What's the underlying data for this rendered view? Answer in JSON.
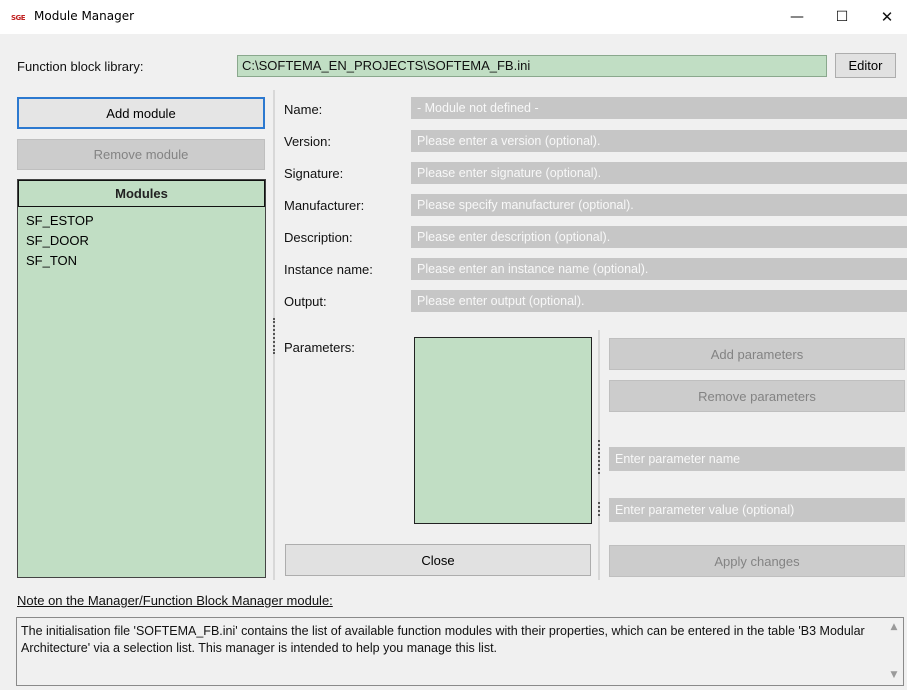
{
  "window": {
    "title": "Module Manager",
    "icon_text": "SGE",
    "min_glyph": "—",
    "max_glyph": "☐",
    "close_glyph": "✕"
  },
  "library": {
    "label": "Function block library:",
    "path": "C:\\SOFTEMA_EN_PROJECTS\\SOFTEMA_FB.ini",
    "editor_label": "Editor"
  },
  "modules": {
    "add_label": "Add module",
    "remove_label": "Remove module",
    "header": "Modules",
    "items": [
      "SF_ESTOP",
      "SF_DOOR",
      "SF_TON"
    ]
  },
  "form": {
    "name_label": "Name:",
    "name_value": "- Module not defined -",
    "version_label": "Version:",
    "version_placeholder": "Please enter a version (optional).",
    "signature_label": "Signature:",
    "signature_placeholder": "Please enter signature (optional).",
    "manufacturer_label": "Manufacturer:",
    "manufacturer_placeholder": "Please specify manufacturer (optional).",
    "description_label": "Description:",
    "description_placeholder": "Please enter description (optional).",
    "instance_label": "Instance name:",
    "instance_placeholder": "Please enter an instance name (optional).",
    "output_label": "Output:",
    "output_placeholder": "Please enter output (optional)."
  },
  "parameters": {
    "label": "Parameters:",
    "add_label": "Add parameters",
    "remove_label": "Remove parameters",
    "name_placeholder": "Enter parameter name",
    "value_placeholder": "Enter parameter value (optional)"
  },
  "actions": {
    "close_label": "Close",
    "apply_label": "Apply changes"
  },
  "note": {
    "title": "Note on the Manager/Function Block Manager module:",
    "text": "The initialisation file 'SOFTEMA_FB.ini' contains the list of available function modules with their properties, which can be entered in the table 'B3 Modular Architecture' via a selection list. This manager is intended to help you manage this list."
  },
  "colors": {
    "field_green": "#c1dec4",
    "focus_blue": "#2c79d0",
    "disabled_gray": "#c6c6c6"
  }
}
